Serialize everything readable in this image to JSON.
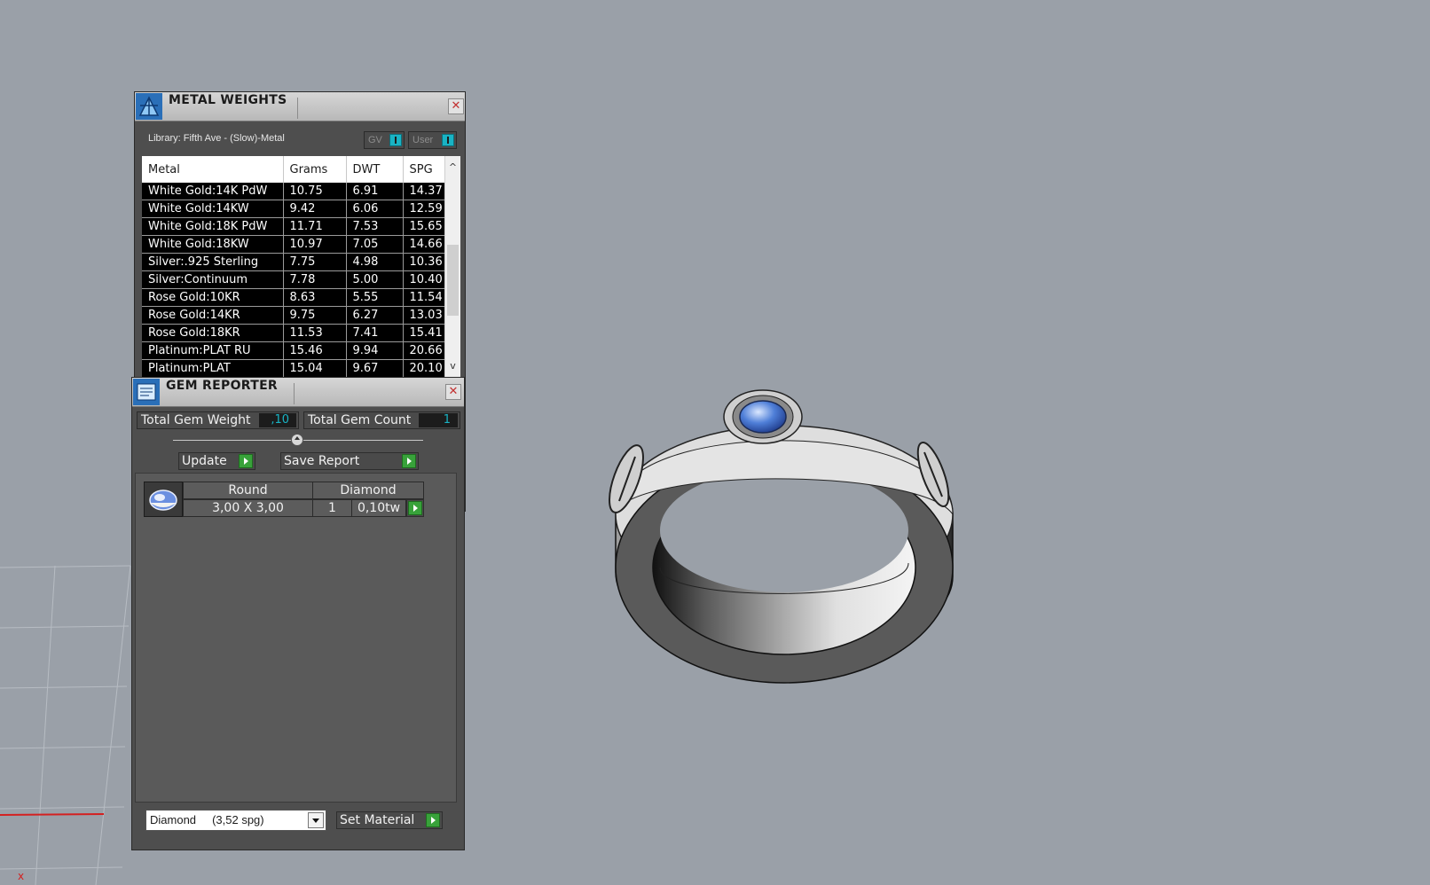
{
  "metal_weights": {
    "title": "METAL WEIGHTS",
    "library_label": "Library: Fifth Ave - (Slow)-Metal",
    "toggles": [
      {
        "label": "GV",
        "icon": "toggle-indicator"
      },
      {
        "label": "User",
        "icon": "toggle-indicator"
      }
    ],
    "columns": [
      "Metal",
      "Grams",
      "DWT",
      "SPG"
    ],
    "rows": [
      [
        "White Gold:14K PdW",
        "10.75",
        "6.91",
        "14.37"
      ],
      [
        "White Gold:14KW",
        "9.42",
        "6.06",
        "12.59"
      ],
      [
        "White Gold:18K PdW",
        "11.71",
        "7.53",
        "15.65"
      ],
      [
        "White Gold:18KW",
        "10.97",
        "7.05",
        "14.66"
      ],
      [
        "Silver:.925 Sterling",
        "7.75",
        "4.98",
        "10.36"
      ],
      [
        "Silver:Continuum",
        "7.78",
        "5.00",
        "10.40"
      ],
      [
        "Rose Gold:10KR",
        "8.63",
        "5.55",
        "11.54"
      ],
      [
        "Rose Gold:14KR",
        "9.75",
        "6.27",
        "13.03"
      ],
      [
        "Rose Gold:18KR",
        "11.53",
        "7.41",
        "15.41"
      ],
      [
        "Platinum:PLAT RU",
        "15.46",
        "9.94",
        "20.66"
      ],
      [
        "Platinum:PLAT",
        "15.04",
        "9.67",
        "20.10"
      ]
    ],
    "scroll_up_glyph": "^",
    "scroll_down_glyph": "v",
    "close_glyph": "✕"
  },
  "gem_reporter": {
    "title": "GEM REPORTER",
    "close_glyph": "✕",
    "total_weight_label": "Total Gem Weight",
    "total_weight_value": ",10",
    "total_count_label": "Total Gem Count",
    "total_count_value": "1",
    "update_label": "Update",
    "save_report_label": "Save Report",
    "gem_table": {
      "headers": [
        "Round",
        "Diamond"
      ],
      "row": {
        "size": "3,00 X 3,00",
        "count": "1",
        "weight": "0,10tw"
      }
    },
    "material_select": "Diamond     (3,52 spg)",
    "set_material_label": "Set Material"
  },
  "viewport": {
    "axis_label": "x",
    "colors": {
      "background": "#9aa0a8",
      "axis_x": "#d42020",
      "stone": "#4f7fd8",
      "accent": "#19b3c4"
    }
  }
}
